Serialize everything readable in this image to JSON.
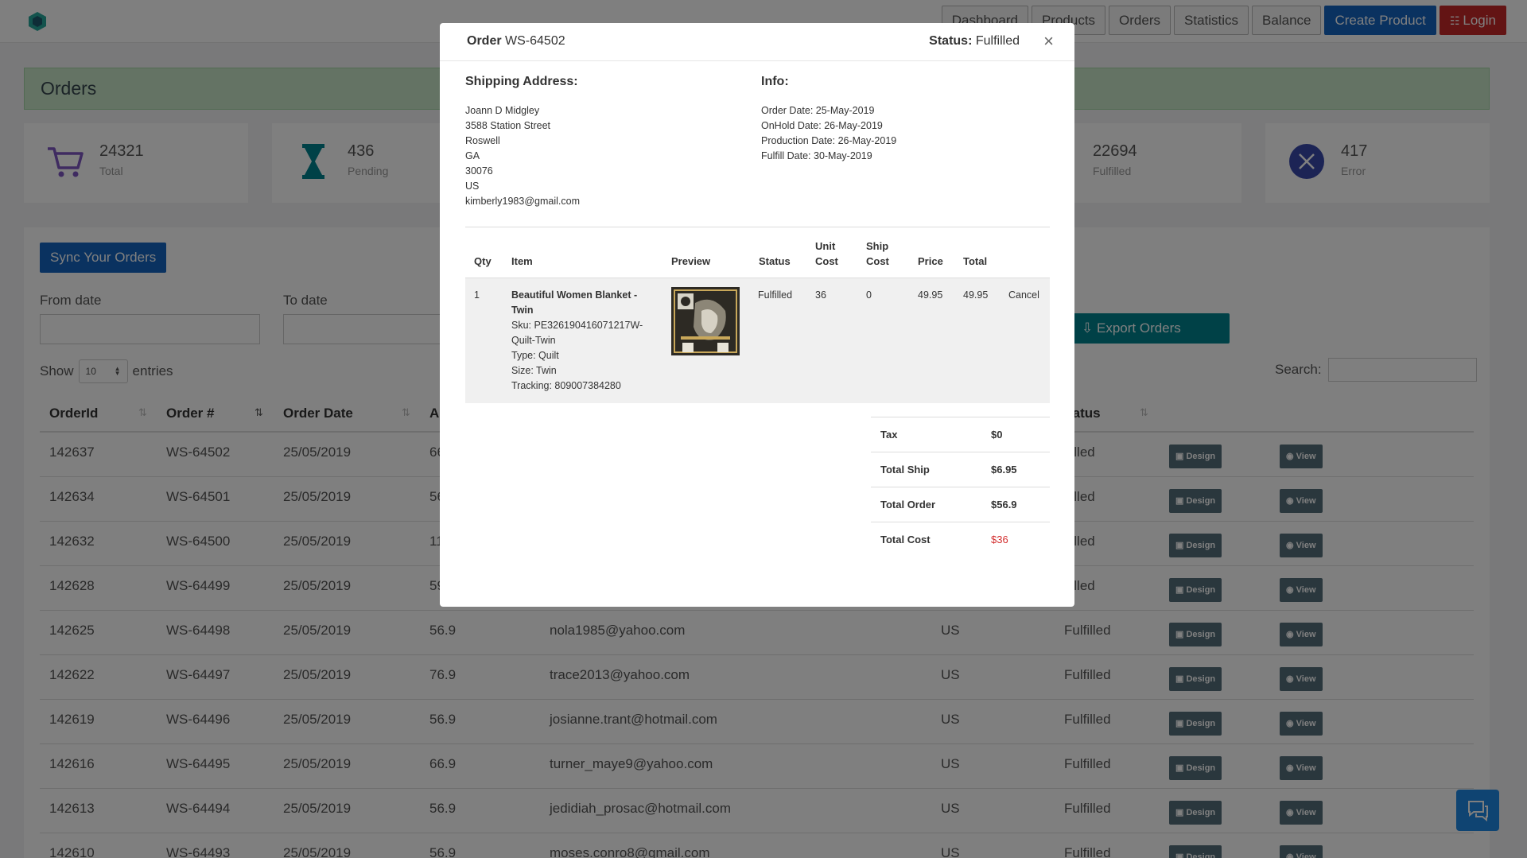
{
  "nav": {
    "items": [
      "Dashboard",
      "Products",
      "Orders",
      "Statistics",
      "Balance"
    ],
    "create_product": "Create Product",
    "login": "Login"
  },
  "page": {
    "title": "Orders"
  },
  "stats": [
    {
      "value": "24321",
      "label": "Total",
      "icon": "cart-icon"
    },
    {
      "value": "436",
      "label": "Pending",
      "icon": "hourglass-icon"
    },
    {
      "value": "22694",
      "label": "Fulfilled",
      "icon": "check-icon"
    },
    {
      "value": "417",
      "label": "Error",
      "icon": "x-circle-icon"
    }
  ],
  "controls": {
    "sync": "Sync Your Orders",
    "from_date": "From date",
    "to_date": "To date",
    "export": "Export Orders",
    "show": "Show",
    "entries_count": "10",
    "entries": "entries",
    "search": "Search:"
  },
  "table": {
    "columns": [
      "OrderId",
      "Order #",
      "Order Date",
      "A",
      "tatus"
    ],
    "design_label": "Design",
    "view_label": "View",
    "rows": [
      {
        "id": "142637",
        "num": "WS-64502",
        "date": "25/05/2019",
        "amount": "66",
        "email": "",
        "country": "",
        "status": "lfilled"
      },
      {
        "id": "142634",
        "num": "WS-64501",
        "date": "25/05/2019",
        "amount": "56",
        "email": "",
        "country": "",
        "status": "lfilled"
      },
      {
        "id": "142632",
        "num": "WS-64500",
        "date": "25/05/2019",
        "amount": "11",
        "email": "",
        "country": "",
        "status": "lfilled"
      },
      {
        "id": "142628",
        "num": "WS-64499",
        "date": "25/05/2019",
        "amount": "59",
        "email": "",
        "country": "",
        "status": "lfilled"
      },
      {
        "id": "142625",
        "num": "WS-64498",
        "date": "25/05/2019",
        "amount": "56.9",
        "email": "nola1985@yahoo.com",
        "country": "US",
        "status": "Fulfilled"
      },
      {
        "id": "142622",
        "num": "WS-64497",
        "date": "25/05/2019",
        "amount": "76.9",
        "email": "trace2013@yahoo.com",
        "country": "US",
        "status": "Fulfilled"
      },
      {
        "id": "142619",
        "num": "WS-64496",
        "date": "25/05/2019",
        "amount": "56.9",
        "email": "josianne.trant@hotmail.com",
        "country": "US",
        "status": "Fulfilled"
      },
      {
        "id": "142616",
        "num": "WS-64495",
        "date": "25/05/2019",
        "amount": "66.9",
        "email": "turner_maye9@yahoo.com",
        "country": "US",
        "status": "Fulfilled"
      },
      {
        "id": "142613",
        "num": "WS-64494",
        "date": "25/05/2019",
        "amount": "56.9",
        "email": "jedidiah_prosac@hotmail.com",
        "country": "US",
        "status": "Fulfilled"
      },
      {
        "id": "142610",
        "num": "WS-64493",
        "date": "25/05/2019",
        "amount": "56.9",
        "email": "moses.conro8@gmail.com",
        "country": "US",
        "status": "Fulfilled"
      }
    ]
  },
  "modal": {
    "order_label": "Order",
    "order_number": "WS-64502",
    "status_label": "Status:",
    "status_value": "Fulfilled",
    "close": "×",
    "shipping_title": "Shipping Address:",
    "address_lines": [
      "Joann D Midgley",
      "3588 Station Street",
      "Roswell",
      "GA",
      "30076",
      "US",
      "kimberly1983@gmail.com"
    ],
    "info_title": "Info:",
    "info_lines": [
      "Order Date: 25-May-2019",
      "OnHold Date: 26-May-2019",
      "Production Date: 26-May-2019",
      "Fulfill Date: 30-May-2019"
    ],
    "item_columns": {
      "qty": "Qty",
      "item": "Item",
      "preview": "Preview",
      "status": "Status",
      "unit_1": "Unit",
      "unit_2": "Cost",
      "ship_1": "Ship",
      "ship_2": "Cost",
      "price": "Price",
      "total": "Total"
    },
    "item": {
      "qty": "1",
      "name_1": "Beautiful Women Blanket -",
      "name_2": "Twin",
      "sku_1": "Sku: PE326190416071217W-",
      "sku_2": "Quilt-Twin",
      "type": "Type: Quilt",
      "size": "Size: Twin",
      "tracking": "Tracking: 809007384280",
      "status": "Fulfilled",
      "unit_cost": "36",
      "ship_cost": "0",
      "price": "49.95",
      "total": "49.95",
      "action": "Cancel"
    },
    "totals": [
      {
        "label": "Tax",
        "value": "$0"
      },
      {
        "label": "Total Ship",
        "value": "$6.95"
      },
      {
        "label": "Total Order",
        "value": "$56.9"
      },
      {
        "label": "Total Cost",
        "value": "$36"
      }
    ],
    "accent": "#d32f2f"
  }
}
